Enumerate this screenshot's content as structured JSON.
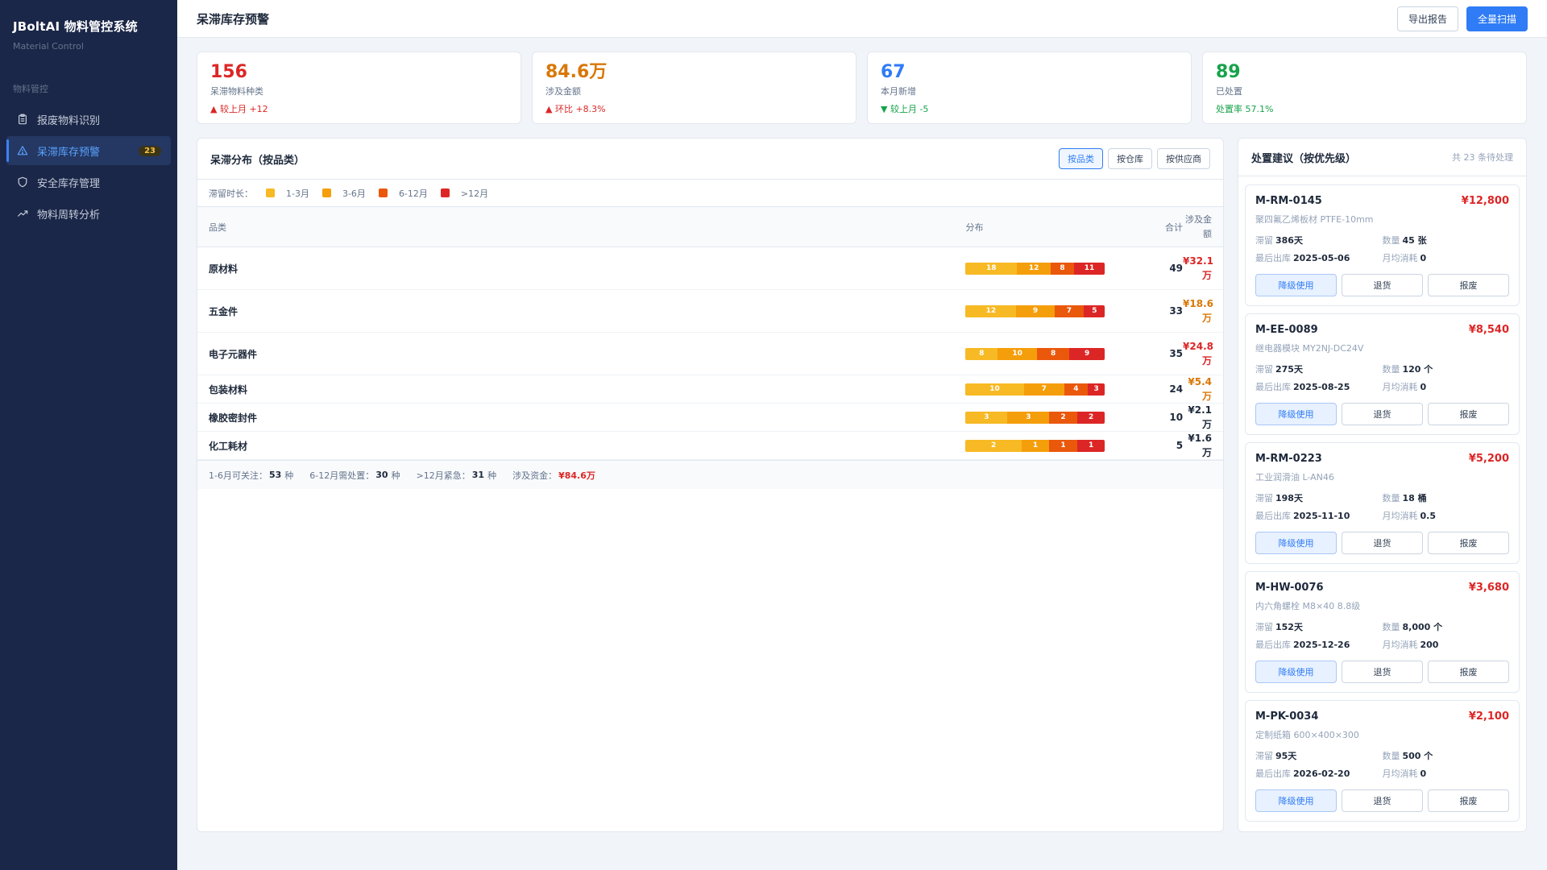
{
  "brand": {
    "title": "JBoltAI 物料管控系统",
    "subtitle": "Material Control"
  },
  "sidebar": {
    "section": "物料管控",
    "items": [
      {
        "label": "报废物料识别",
        "icon": "clipboard-icon",
        "active": false,
        "badge": ""
      },
      {
        "label": "呆滞库存预警",
        "icon": "warning-triangle-icon",
        "active": true,
        "badge": "23"
      },
      {
        "label": "安全库存管理",
        "icon": "shield-icon",
        "active": false,
        "badge": ""
      },
      {
        "label": "物料周转分析",
        "icon": "trend-icon",
        "active": false,
        "badge": ""
      }
    ]
  },
  "header": {
    "title": "呆滞库存预警",
    "export_label": "导出报告",
    "scan_label": "全量扫描"
  },
  "kpis": [
    {
      "value": "156",
      "label": "呆滞物料种类",
      "trend": "▲ 较上月 +12",
      "color": "#dc2626",
      "trend_color": "#dc2626"
    },
    {
      "value": "84.6万",
      "label": "涉及金额",
      "trend": "▲ 环比 +8.3%",
      "color": "#d97706",
      "trend_color": "#dc2626"
    },
    {
      "value": "67",
      "label": "本月新增",
      "trend": "▼ 较上月 -5",
      "color": "#2f7cf6",
      "trend_color": "#16a34a"
    },
    {
      "value": "89",
      "label": "已处置",
      "trend": "处置率 57.1%",
      "color": "#16a34a",
      "trend_color": "#16a34a"
    }
  ],
  "distribution": {
    "title": "呆滞分布（按品类）",
    "tabs": [
      {
        "label": "按品类",
        "active": true
      },
      {
        "label": "按仓库",
        "active": false
      },
      {
        "label": "按供应商",
        "active": false
      }
    ],
    "legend_title": "滞留时长：",
    "legend": [
      {
        "label": "1-3月",
        "color": "#f7b924"
      },
      {
        "label": "3-6月",
        "color": "#f59e0b"
      },
      {
        "label": "6-12月",
        "color": "#ea580c"
      },
      {
        "label": ">12月",
        "color": "#dc2626"
      }
    ],
    "columns": {
      "category": "品类",
      "distribution": "分布",
      "total": "合计",
      "amount": "涉及金额"
    },
    "rows": [
      {
        "category": "原材料",
        "segments": [
          18,
          12,
          8,
          11
        ],
        "total": "49",
        "amount": "¥32.1万",
        "amount_color": "#dc2626"
      },
      {
        "category": "五金件",
        "segments": [
          12,
          9,
          7,
          5
        ],
        "total": "33",
        "amount": "¥18.6万",
        "amount_color": "#d97706"
      },
      {
        "category": "电子元器件",
        "segments": [
          8,
          10,
          8,
          9
        ],
        "total": "35",
        "amount": "¥24.8万",
        "amount_color": "#dc2626"
      },
      {
        "category": "包装材料",
        "segments": [
          10,
          7,
          4,
          3
        ],
        "total": "24",
        "amount": "¥5.4万",
        "amount_color": "#d97706"
      },
      {
        "category": "橡胶密封件",
        "segments": [
          3,
          3,
          2,
          2
        ],
        "total": "10",
        "amount": "¥2.1万",
        "amount_color": "#1e293b"
      },
      {
        "category": "化工耗材",
        "segments": [
          2,
          1,
          1,
          1
        ],
        "total": "5",
        "amount": "¥1.6万",
        "amount_color": "#1e293b"
      }
    ],
    "summary": [
      {
        "label": "1-6月可关注：",
        "value": "53",
        "unit": "种"
      },
      {
        "label": "6-12月需处置：",
        "value": "30",
        "unit": "种"
      },
      {
        "label": ">12月紧急：",
        "value": "31",
        "unit": "种"
      },
      {
        "label": "涉及资金：",
        "value": "¥84.6万",
        "unit": ""
      }
    ]
  },
  "suggestions": {
    "title": "处置建议（按优先级）",
    "count": "共 23 条待处理",
    "stay_label": "滞留",
    "qty_label": "数量",
    "last_out_label": "最后出库",
    "monthly_label": "月均消耗",
    "actions": [
      "降级使用",
      "退货",
      "报废"
    ],
    "items": [
      {
        "code": "M-RM-0145",
        "price": "¥12,800",
        "name": "聚四氟乙烯板材 PTFE-10mm",
        "stay": "386天",
        "qty": "45 张",
        "last_out": "2025-05-06",
        "monthly": "0"
      },
      {
        "code": "M-EE-0089",
        "price": "¥8,540",
        "name": "继电器模块 MY2NJ-DC24V",
        "stay": "275天",
        "qty": "120 个",
        "last_out": "2025-08-25",
        "monthly": "0"
      },
      {
        "code": "M-RM-0223",
        "price": "¥5,200",
        "name": "工业润滑油 L-AN46",
        "stay": "198天",
        "qty": "18 桶",
        "last_out": "2025-11-10",
        "monthly": "0.5"
      },
      {
        "code": "M-HW-0076",
        "price": "¥3,680",
        "name": "内六角螺栓 M8×40 8.8级",
        "stay": "152天",
        "qty": "8,000 个",
        "last_out": "2025-12-26",
        "monthly": "200"
      },
      {
        "code": "M-PK-0034",
        "price": "¥2,100",
        "name": "定制纸箱 600×400×300",
        "stay": "95天",
        "qty": "500 个",
        "last_out": "2026-02-20",
        "monthly": "0"
      }
    ]
  }
}
